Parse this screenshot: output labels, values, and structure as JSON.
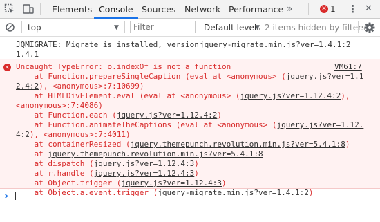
{
  "tabbar": {
    "tabs": [
      {
        "label": "Elements"
      },
      {
        "label": "Console",
        "active": true
      },
      {
        "label": "Sources"
      },
      {
        "label": "Network"
      },
      {
        "label": "Performance"
      }
    ],
    "more_glyph": "»",
    "error_count": "1",
    "menu_glyph": "⋮",
    "close_glyph": "✕"
  },
  "filterbar": {
    "context": "top",
    "filter_placeholder": "Filter",
    "levels_label": "Default levels",
    "hidden_text": "2 items hidden by filters"
  },
  "console": {
    "info": {
      "line1": "JQMIGRATE: Migrate is installed, version",
      "line2": "1.4.1",
      "source": "jquery-migrate.min.js?ver=1.4.1:2"
    },
    "error": {
      "header": "Uncaught TypeError: o.indexOf is not a function",
      "source": "VM61:7",
      "stack": [
        {
          "pre": "    at Function.prepareSingleCaption (eval at <anonymous> (",
          "link": "jquery.js?ver=1.1",
          "post": ""
        },
        {
          "pre": "",
          "link": "2.4:2",
          "post": "), <anonymous>:7:10699)"
        },
        {
          "pre": "    at HTMLDivElement.eval (eval at <anonymous> (",
          "link": "jquery.js?ver=1.12.4:2",
          "post": "),"
        },
        {
          "pre": "<anonymous>:7:4086)",
          "link": "",
          "post": ""
        },
        {
          "pre": "    at Function.each (",
          "link": "jquery.js?ver=1.12.4:2",
          "post": ")"
        },
        {
          "pre": "    at Function.animateTheCaptions (eval at <anonymous> (",
          "link": "jquery.js?ver=1.12.",
          "post": ""
        },
        {
          "pre": "",
          "link": "4:2",
          "post": "), <anonymous>:7:4011)"
        },
        {
          "pre": "    at containerResized (",
          "link": "jquery.themepunch.revolution.min.js?ver=5.4.1:8",
          "post": ")"
        },
        {
          "pre": "    at ",
          "link": "jquery.themepunch.revolution.min.js?ver=5.4.1:8",
          "post": ""
        },
        {
          "pre": "    at dispatch (",
          "link": "jquery.js?ver=1.12.4:3",
          "post": ")"
        },
        {
          "pre": "    at r.handle (",
          "link": "jquery.js?ver=1.12.4:3",
          "post": ")"
        },
        {
          "pre": "    at Object.trigger (",
          "link": "jquery.js?ver=1.12.4:3",
          "post": ")"
        },
        {
          "pre": "    at Object.a.event.trigger (",
          "link": "jquery-migrate.min.js?ver=1.4.1:2",
          "post": ")"
        }
      ]
    },
    "prompt_glyph": "›"
  },
  "colors": {
    "accent": "#1a73e8",
    "error_red": "#d92b2b",
    "error_bg": "#fff2f2"
  }
}
